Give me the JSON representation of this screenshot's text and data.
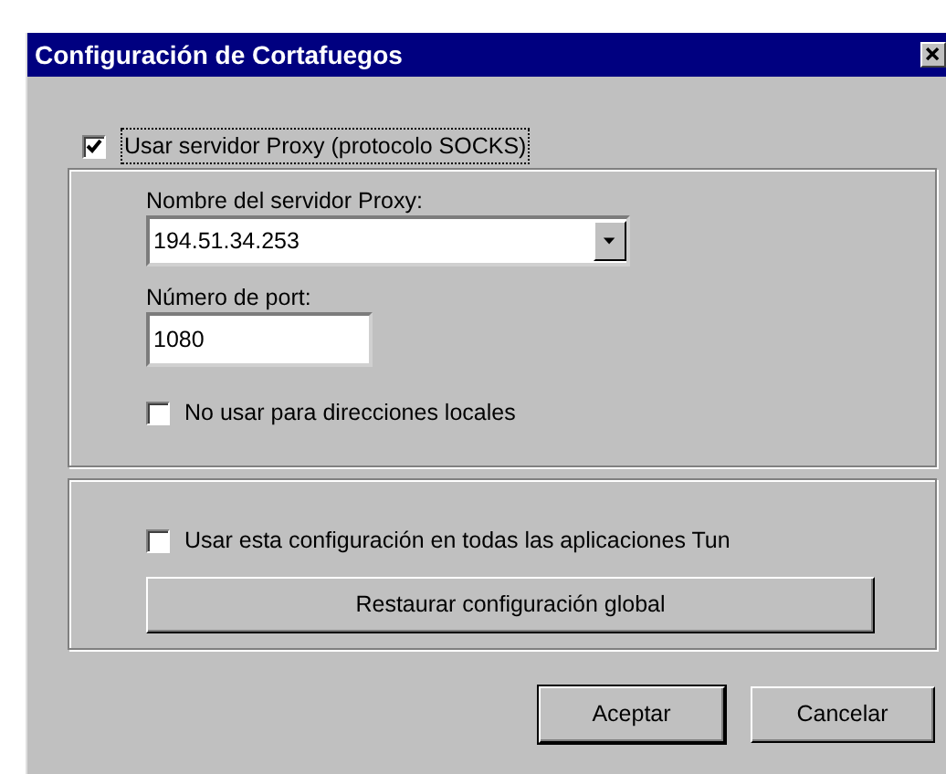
{
  "window": {
    "title": "Configuración de Cortafuegos"
  },
  "use_proxy": {
    "label": "Usar servidor Proxy (protocolo SOCKS)",
    "checked": true
  },
  "proxy_group": {
    "server_label": "Nombre del servidor Proxy:",
    "server_value": "194.51.34.253",
    "port_label": "Número de port:",
    "port_value": "1080",
    "no_local": {
      "label": "No usar para direcciones locales",
      "checked": false
    }
  },
  "global_group": {
    "all_apps": {
      "label": "Usar esta configuración en todas las aplicaciones Tun",
      "checked": false
    },
    "restore_button": "Restaurar configuración global"
  },
  "buttons": [
    {
      "label": "Aceptar",
      "default": true
    },
    {
      "label": "Cancelar",
      "default": false
    }
  ]
}
